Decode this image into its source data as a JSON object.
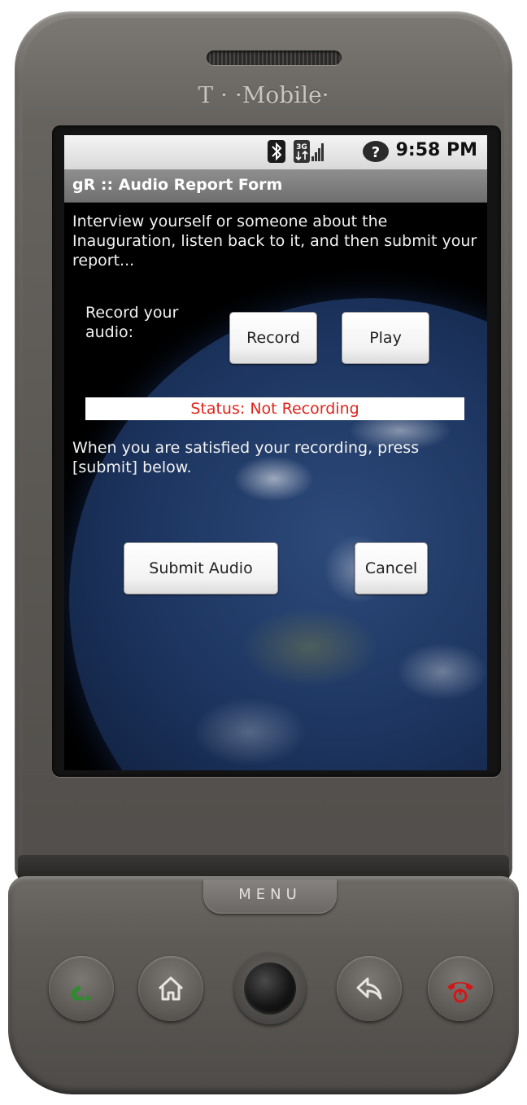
{
  "device": {
    "brand": "T · ·Mobile·",
    "menu_label": "MENU"
  },
  "status_bar": {
    "time": "9:58 PM",
    "icons": [
      "bluetooth-icon",
      "3g-data-icon",
      "signal-strength-icon",
      "help-icon"
    ]
  },
  "app": {
    "title": "gR :: Audio Report Form"
  },
  "form": {
    "intro_text": "Interview yourself or someone about the Inauguration, listen back to it, and then submit your report...",
    "record_label": "Record your audio:",
    "record_button": "Record",
    "play_button": "Play",
    "status": "Status: Not Recording",
    "instructions": "When you are satisfied your recording, press [submit] below.",
    "submit_button": "Submit Audio",
    "cancel_button": "Cancel"
  },
  "colors": {
    "status_text": "#e0241b",
    "call_key": "#2e8b2e",
    "end_key": "#d01818"
  },
  "hardware_keys": [
    "call-icon",
    "home-icon",
    "trackball",
    "back-icon",
    "end-call-icon"
  ]
}
